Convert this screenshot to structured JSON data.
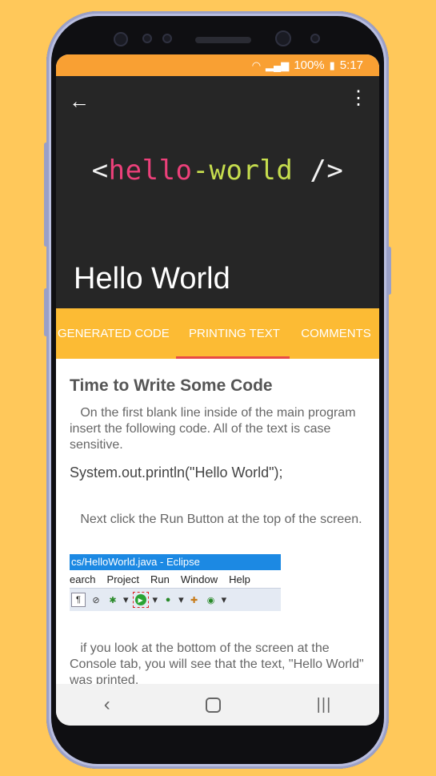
{
  "status": {
    "time": "5:17",
    "battery": "100%"
  },
  "toolbar": {
    "logo_open": "<",
    "logo_hello": "hello",
    "logo_dash": "-",
    "logo_world": "world",
    "logo_close": " />",
    "title": "Hello World"
  },
  "tabs": [
    {
      "label": "GENERATED CODE"
    },
    {
      "label": "PRINTING TEXT"
    },
    {
      "label": "COMMENTS"
    }
  ],
  "content": {
    "heading": "Time to Write Some Code",
    "para1": "On the first blank line inside of the main program insert the following code.  All of the text is case sensitive.",
    "code": "System.out.println(\"Hello World\");",
    "para2": "Next click the Run Button at the top of the screen.",
    "eclipse": {
      "title": "cs/HelloWorld.java - Eclipse",
      "menus": [
        "earch",
        "Project",
        "Run",
        "Window",
        "Help"
      ]
    },
    "para3": "if you look at the bottom of the screen at the Console tab, you will see that the text, \"Hello World\" was printed."
  },
  "colors": {
    "status_bar": "#F9A033",
    "tab_bar": "#FCBB34",
    "indicator": "#E94A45",
    "toolbar_bg": "#262626"
  },
  "icons": {
    "back": "arrow-left-icon",
    "more": "more-vert-icon",
    "nav_back": "chevron-left-icon",
    "nav_home": "home-circle-icon",
    "nav_recent": "recent-apps-icon"
  }
}
